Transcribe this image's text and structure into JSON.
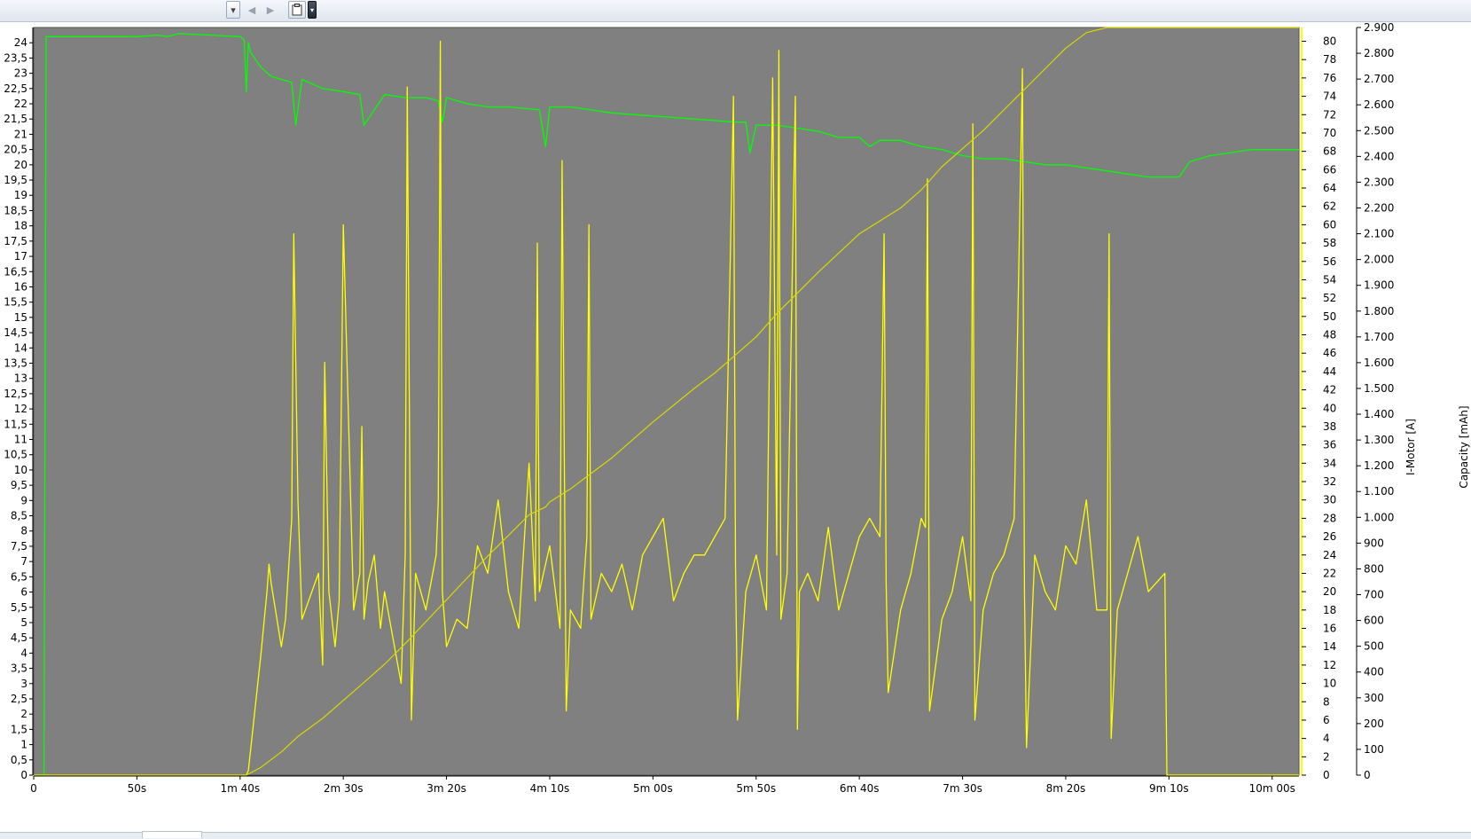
{
  "toolbar": {
    "dropdown_icon": "chevron-down-icon",
    "back_icon": "arrow-left-icon",
    "forward_icon": "arrow-right-icon",
    "clipboard_icon": "clipboard-icon",
    "menu_icon": "chevron-down-icon"
  },
  "colors": {
    "plot_bg": "#808080",
    "voltage_line": "#00ff00",
    "current_line": "#ffff00",
    "capacity_line": "#d8d800",
    "axis_right_line": "#ffff00"
  },
  "chart_data": {
    "type": "line",
    "title": "",
    "xlabel": "",
    "x_tick_labels": [
      "0",
      "50s",
      "1m 40s",
      "2m 30s",
      "3m 20s",
      "4m 10s",
      "5m 00s",
      "5m 50s",
      "6m 40s",
      "7m 30s",
      "8m 20s",
      "9m 10s",
      "10m 00s"
    ],
    "x_ticks_seconds": [
      0,
      50,
      100,
      150,
      200,
      250,
      300,
      350,
      400,
      450,
      500,
      550,
      600
    ],
    "xlim_seconds": [
      0,
      613
    ],
    "left_axis": {
      "label": "",
      "ylim": [
        0,
        24.5
      ],
      "tick_labels": [
        "0",
        "0,5",
        "1",
        "1,5",
        "2",
        "2,5",
        "3",
        "3,5",
        "4",
        "4,5",
        "5",
        "5,5",
        "6",
        "6,5",
        "7",
        "7,5",
        "8",
        "8,5",
        "9",
        "9,5",
        "10",
        "10,5",
        "11",
        "11,5",
        "12",
        "12,5",
        "13",
        "13,5",
        "14",
        "14,5",
        "15",
        "15,5",
        "16",
        "16,5",
        "17",
        "17,5",
        "18",
        "18,5",
        "19",
        "19,5",
        "20",
        "20,5",
        "21",
        "21,5",
        "22",
        "22,5",
        "23",
        "23,5",
        "24"
      ]
    },
    "right_axis_current": {
      "label": "I-Motor [A]",
      "ylim": [
        0,
        81.5
      ],
      "tick_labels": [
        "0",
        "2",
        "4",
        "6",
        "8",
        "10",
        "12",
        "14",
        "16",
        "18",
        "20",
        "22",
        "24",
        "26",
        "28",
        "30",
        "32",
        "34",
        "36",
        "38",
        "40",
        "42",
        "44",
        "46",
        "48",
        "50",
        "52",
        "54",
        "56",
        "58",
        "60",
        "62",
        "64",
        "66",
        "68",
        "70",
        "72",
        "74",
        "76",
        "78",
        "80"
      ]
    },
    "right_axis_capacity": {
      "label": "Capacity [mAh]",
      "ylim": [
        0,
        2900
      ],
      "tick_labels": [
        "0",
        "100",
        "200",
        "300",
        "400",
        "500",
        "600",
        "700",
        "800",
        "900",
        "1.000",
        "1.100",
        "1.200",
        "1.300",
        "1.400",
        "1.500",
        "1.600",
        "1.700",
        "1.800",
        "1.900",
        "2.000",
        "2.100",
        "2.200",
        "2.300",
        "2.400",
        "2.500",
        "2.600",
        "2.700",
        "2.800",
        "2.900"
      ]
    },
    "series": [
      {
        "axis": "left",
        "x": [
          0,
          5,
          6,
          50,
          60,
          65,
          70,
          100,
          102,
          103,
          104,
          105,
          110,
          115,
          125,
          127,
          130,
          140,
          150,
          158,
          160,
          170,
          180,
          190,
          196,
          198,
          200,
          210,
          220,
          230,
          245,
          248,
          250,
          255,
          260,
          270,
          280,
          300,
          320,
          340,
          345,
          347,
          350,
          360,
          370,
          380,
          390,
          400,
          405,
          410,
          420,
          430,
          440,
          450,
          460,
          470,
          480,
          490,
          500,
          510,
          520,
          530,
          540,
          552,
          555,
          560,
          570,
          580,
          590,
          600,
          613
        ],
        "y": [
          0,
          0,
          24.2,
          24.2,
          24.25,
          24.2,
          24.3,
          24.2,
          24.1,
          22.4,
          24.0,
          23.7,
          23.2,
          22.9,
          22.7,
          21.3,
          22.8,
          22.5,
          22.4,
          22.3,
          21.3,
          22.3,
          22.2,
          22.2,
          22.1,
          21.4,
          22.2,
          22.0,
          21.9,
          21.9,
          21.8,
          20.6,
          21.9,
          21.9,
          21.9,
          21.8,
          21.7,
          21.6,
          21.5,
          21.4,
          21.4,
          20.4,
          21.3,
          21.3,
          21.2,
          21.1,
          20.9,
          20.9,
          20.6,
          20.8,
          20.8,
          20.6,
          20.5,
          20.3,
          20.2,
          20.2,
          20.1,
          20.0,
          20.0,
          19.9,
          19.8,
          19.7,
          19.6,
          19.6,
          19.6,
          20.1,
          20.3,
          20.4,
          20.5,
          20.5,
          20.5
        ]
      },
      {
        "axis": "right_current",
        "x": [
          0,
          103,
          104,
          110,
          113,
          114,
          115,
          120,
          122,
          125,
          126,
          128,
          130,
          138,
          140,
          141,
          143,
          146,
          148,
          150,
          155,
          158,
          159,
          160,
          162,
          165,
          168,
          170,
          178,
          180,
          181,
          183,
          185,
          190,
          195,
          196,
          197,
          198,
          200,
          205,
          210,
          215,
          220,
          225,
          230,
          235,
          240,
          243,
          244,
          245,
          250,
          255,
          256,
          258,
          260,
          265,
          268,
          269,
          270,
          275,
          280,
          285,
          290,
          295,
          300,
          305,
          310,
          315,
          320,
          325,
          335,
          339,
          340,
          341,
          345,
          350,
          355,
          358,
          360,
          361,
          362,
          365,
          369,
          370,
          371,
          375,
          380,
          385,
          390,
          395,
          400,
          405,
          410,
          412,
          413,
          414,
          420,
          425,
          430,
          432,
          433,
          434,
          440,
          445,
          450,
          454,
          455,
          456,
          460,
          465,
          470,
          475,
          479,
          480,
          481,
          485,
          490,
          495,
          500,
          505,
          510,
          515,
          520,
          521,
          522,
          525,
          530,
          535,
          540,
          548,
          549,
          550,
          613
        ],
        "y": [
          0,
          0,
          0.5,
          13,
          20,
          23,
          21,
          14,
          17,
          28,
          59,
          30,
          17,
          22,
          12,
          45,
          20,
          14,
          19,
          60,
          18,
          22,
          38,
          17,
          21,
          24,
          16,
          20,
          10,
          24,
          75,
          6,
          22,
          18,
          24,
          30,
          80,
          20,
          14,
          17,
          16,
          25,
          22,
          30,
          20,
          16,
          34,
          19,
          58,
          20,
          25,
          16,
          67,
          7,
          18,
          16,
          26,
          60,
          17,
          22,
          20,
          23,
          18,
          24,
          26,
          28,
          19,
          22,
          24,
          24,
          28,
          74,
          23,
          6,
          20,
          24,
          18,
          76,
          24,
          79,
          17,
          22,
          74,
          5,
          20,
          22,
          19,
          27,
          18,
          22,
          26,
          28,
          26,
          59,
          21,
          9,
          18,
          22,
          28,
          27,
          65,
          7,
          17,
          20,
          26,
          19,
          71,
          6,
          18,
          22,
          24,
          28,
          77,
          20,
          3,
          24,
          20,
          18,
          25,
          23,
          30,
          18,
          18,
          59,
          4,
          18,
          22,
          26,
          20,
          22,
          0,
          0,
          0
        ]
      },
      {
        "axis": "right_capacity",
        "x": [
          0,
          103,
          110,
          120,
          128,
          140,
          150,
          160,
          170,
          180,
          200,
          220,
          240,
          248,
          250,
          260,
          270,
          280,
          300,
          320,
          330,
          340,
          350,
          360,
          380,
          400,
          420,
          430,
          440,
          450,
          460,
          470,
          480,
          490,
          500,
          510,
          520,
          530,
          540,
          552,
          560,
          613
        ],
        "y": [
          0,
          0,
          30,
          90,
          150,
          220,
          290,
          360,
          430,
          510,
          680,
          850,
          1010,
          1040,
          1060,
          1110,
          1170,
          1230,
          1370,
          1500,
          1560,
          1630,
          1700,
          1790,
          1950,
          2100,
          2200,
          2270,
          2360,
          2430,
          2500,
          2580,
          2660,
          2740,
          2820,
          2880,
          2900,
          2900,
          2900,
          2900,
          2900,
          2900
        ]
      }
    ],
    "grid": false,
    "legend": "none"
  }
}
